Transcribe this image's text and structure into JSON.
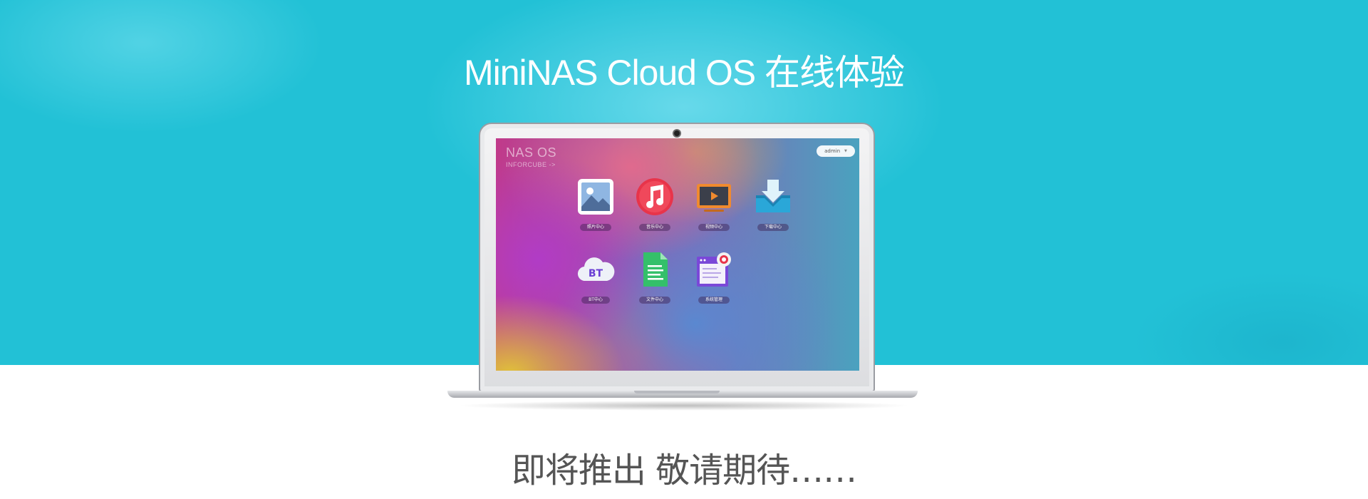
{
  "page": {
    "title": "MiniNAS Cloud OS 在线体验",
    "bottom_message": "即将推出 敬请期待……"
  },
  "screen": {
    "brand_title": "NAS OS",
    "brand_subtitle": "INFORCUBE ->",
    "user_menu_label": "admin",
    "apps": [
      {
        "label": "照片中心",
        "icon": "photo-icon"
      },
      {
        "label": "音乐中心",
        "icon": "music-icon"
      },
      {
        "label": "视频中心",
        "icon": "video-icon"
      },
      {
        "label": "下载中心",
        "icon": "download-icon"
      },
      {
        "label": "BT中心",
        "icon": "bt-cloud-icon",
        "icon_text": "BT"
      },
      {
        "label": "文件中心",
        "icon": "file-icon"
      },
      {
        "label": "系统管理",
        "icon": "system-settings-icon"
      }
    ]
  },
  "colors": {
    "hero_background": "#22c1d6",
    "page_background": "#ffffff",
    "title_text": "#ffffff",
    "message_text": "#555555"
  }
}
